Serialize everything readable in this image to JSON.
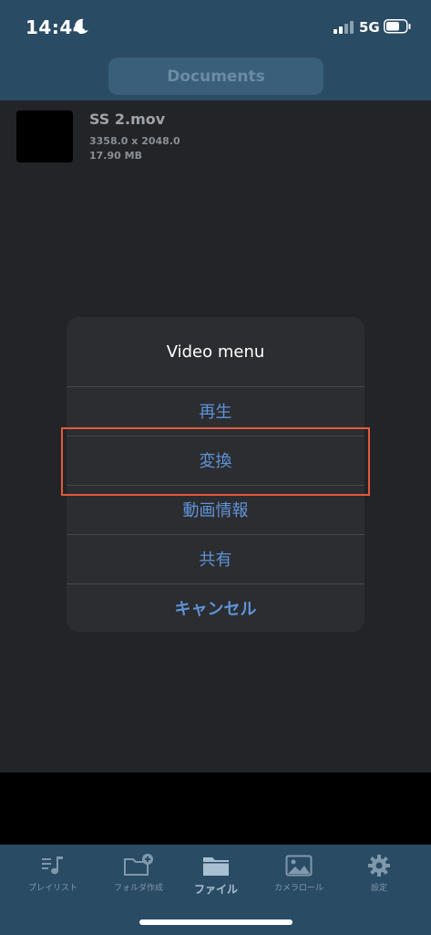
{
  "status_bar": {
    "time": "14:44",
    "network": "5G"
  },
  "header": {
    "title": "Documents"
  },
  "file": {
    "name": "SS 2.mov",
    "dimensions": "3358.0 x 2048.0",
    "size": "17.90 MB"
  },
  "video_menu": {
    "title": "Video menu",
    "items": [
      "再生",
      "変換",
      "動画情報",
      "共有"
    ],
    "cancel": "キャンセル",
    "highlighted_item": "変換"
  },
  "tab_bar": {
    "tabs": [
      {
        "label": "プレイリスト",
        "icon": "playlist-icon"
      },
      {
        "label": "フォルダ作成",
        "icon": "folder-add-icon"
      },
      {
        "label": "ファイル",
        "icon": "folder-icon",
        "active": true
      },
      {
        "label": "カメラロール",
        "icon": "photo-icon"
      },
      {
        "label": "設定",
        "icon": "gear-icon"
      }
    ]
  },
  "colors": {
    "nav_background": "#2a4b64",
    "content_background": "#222428",
    "menu_background": "#2c2d30",
    "menu_accent": "#5f93d8",
    "highlight": "#e25a3a"
  }
}
